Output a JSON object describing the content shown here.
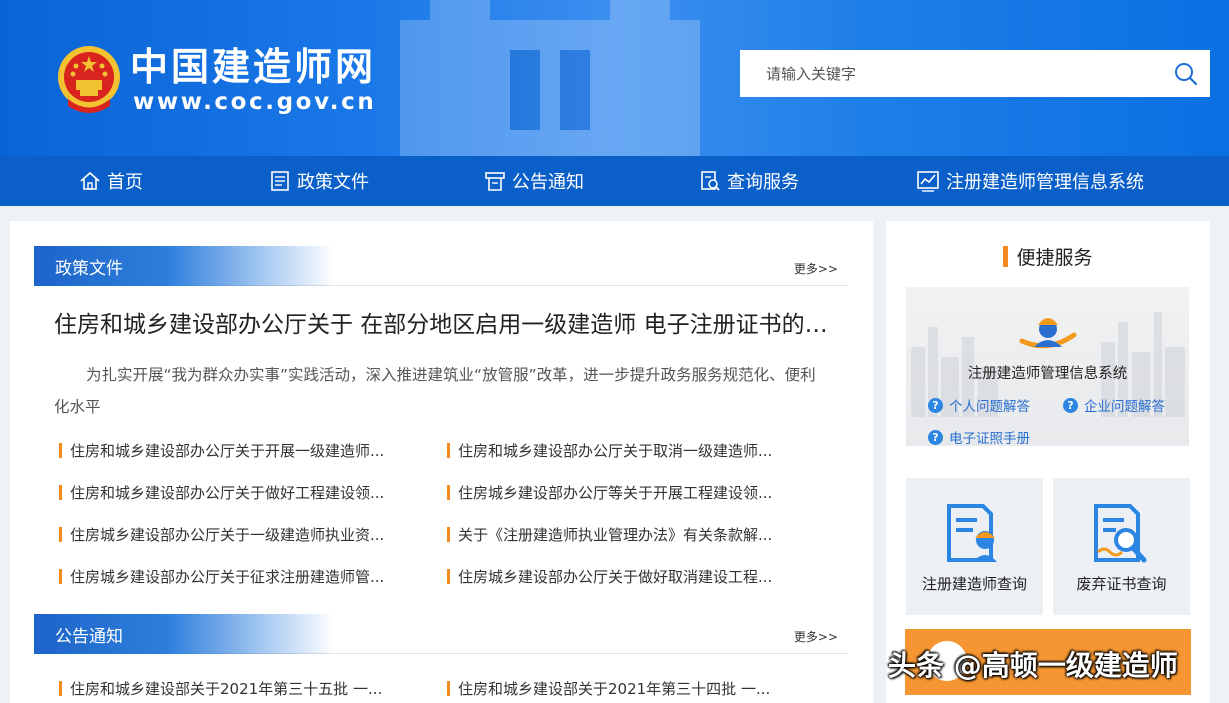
{
  "header": {
    "site_title": "中国建造师网",
    "site_url": "www.coc.gov.cn",
    "search_placeholder": "请输入关键字",
    "bg_color": "#0a64d6"
  },
  "nav": {
    "bg_color": "#0b5fc8",
    "items": [
      {
        "label": "首页",
        "icon": "home-icon"
      },
      {
        "label": "政策文件",
        "icon": "document-icon"
      },
      {
        "label": "公告通知",
        "icon": "notice-icon"
      },
      {
        "label": "查询服务",
        "icon": "search-doc-icon"
      },
      {
        "label": "注册建造师管理信息系统",
        "icon": "chart-icon"
      }
    ]
  },
  "policy": {
    "title": "政策文件",
    "more": "更多>>",
    "headline": "住房和城乡建设部办公厅关于 在部分地区启用一级建造师 电子注册证书的通知",
    "summary": "为扎实开展“我为群众办实事”实践活动，深入推进建筑业“放管服”改革，进一步提升政务服务规范化、便利化水平",
    "items": [
      "住房和城乡建设部办公厅关于开展一级建造师...",
      "住房和城乡建设部办公厅关于取消一级建造师...",
      "住房和城乡建设部办公厅关于做好工程建设领...",
      "住房城乡建设部办公厅等关于开展工程建设领...",
      "住房城乡建设部办公厅关于一级建造师执业资...",
      "关于《注册建造师执业管理办法》有关条款解...",
      "住房城乡建设部办公厅关于征求注册建造师管...",
      "住房城乡建设部办公厅关于做好取消建设工程..."
    ]
  },
  "notice": {
    "title": "公告通知",
    "more": "更多>>",
    "items": [
      "住房和城乡建设部关于2021年第三十五批 一...",
      "住房和城乡建设部关于2021年第三十四批 一..."
    ]
  },
  "sidebar": {
    "title": "便捷服务",
    "system_name": "注册建造师管理信息系统",
    "links": [
      "个人问题解答",
      "企业问题解答",
      "电子证照手册"
    ],
    "tiles": [
      "注册建造师查询",
      "废弃证书查询"
    ],
    "accent_color": "#f58a1f"
  },
  "watermark": "头条 @高顿一级建造师"
}
